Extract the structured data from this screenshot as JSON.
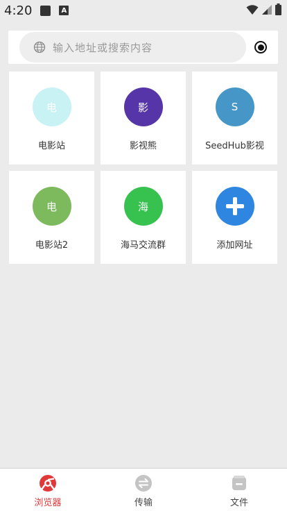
{
  "status_bar": {
    "time": "4:20",
    "notif_letter": "A"
  },
  "search": {
    "placeholder": "输入地址或搜索内容"
  },
  "tiles": [
    {
      "label": "电影站",
      "glyph": "电",
      "color": "#c8f2f4",
      "glyph_color": "#ffffff"
    },
    {
      "label": "影视熊",
      "glyph": "影",
      "color": "#5535a8",
      "glyph_color": "#ffffff"
    },
    {
      "label": "SeedHub影视",
      "glyph": "S",
      "color": "#4697c8",
      "glyph_color": "#ffffff"
    },
    {
      "label": "电影站2",
      "glyph": "电",
      "color": "#7cba5d",
      "glyph_color": "#ffffff"
    },
    {
      "label": "海马交流群",
      "glyph": "海",
      "color": "#37c24f",
      "glyph_color": "#ffffff"
    },
    {
      "label": "添加网址",
      "glyph": "",
      "color": "#2f86e0",
      "glyph_color": "#ffffff",
      "icon": "plus-icon"
    }
  ],
  "bottom_nav": [
    {
      "label": "浏览器",
      "icon": "browser-icon",
      "active": true
    },
    {
      "label": "传输",
      "icon": "transfer-icon",
      "active": false
    },
    {
      "label": "文件",
      "icon": "file-icon",
      "active": false
    }
  ],
  "colors": {
    "accent": "#e0393a",
    "background": "#ebebeb",
    "inactive_icon": "#c4c4c4"
  }
}
